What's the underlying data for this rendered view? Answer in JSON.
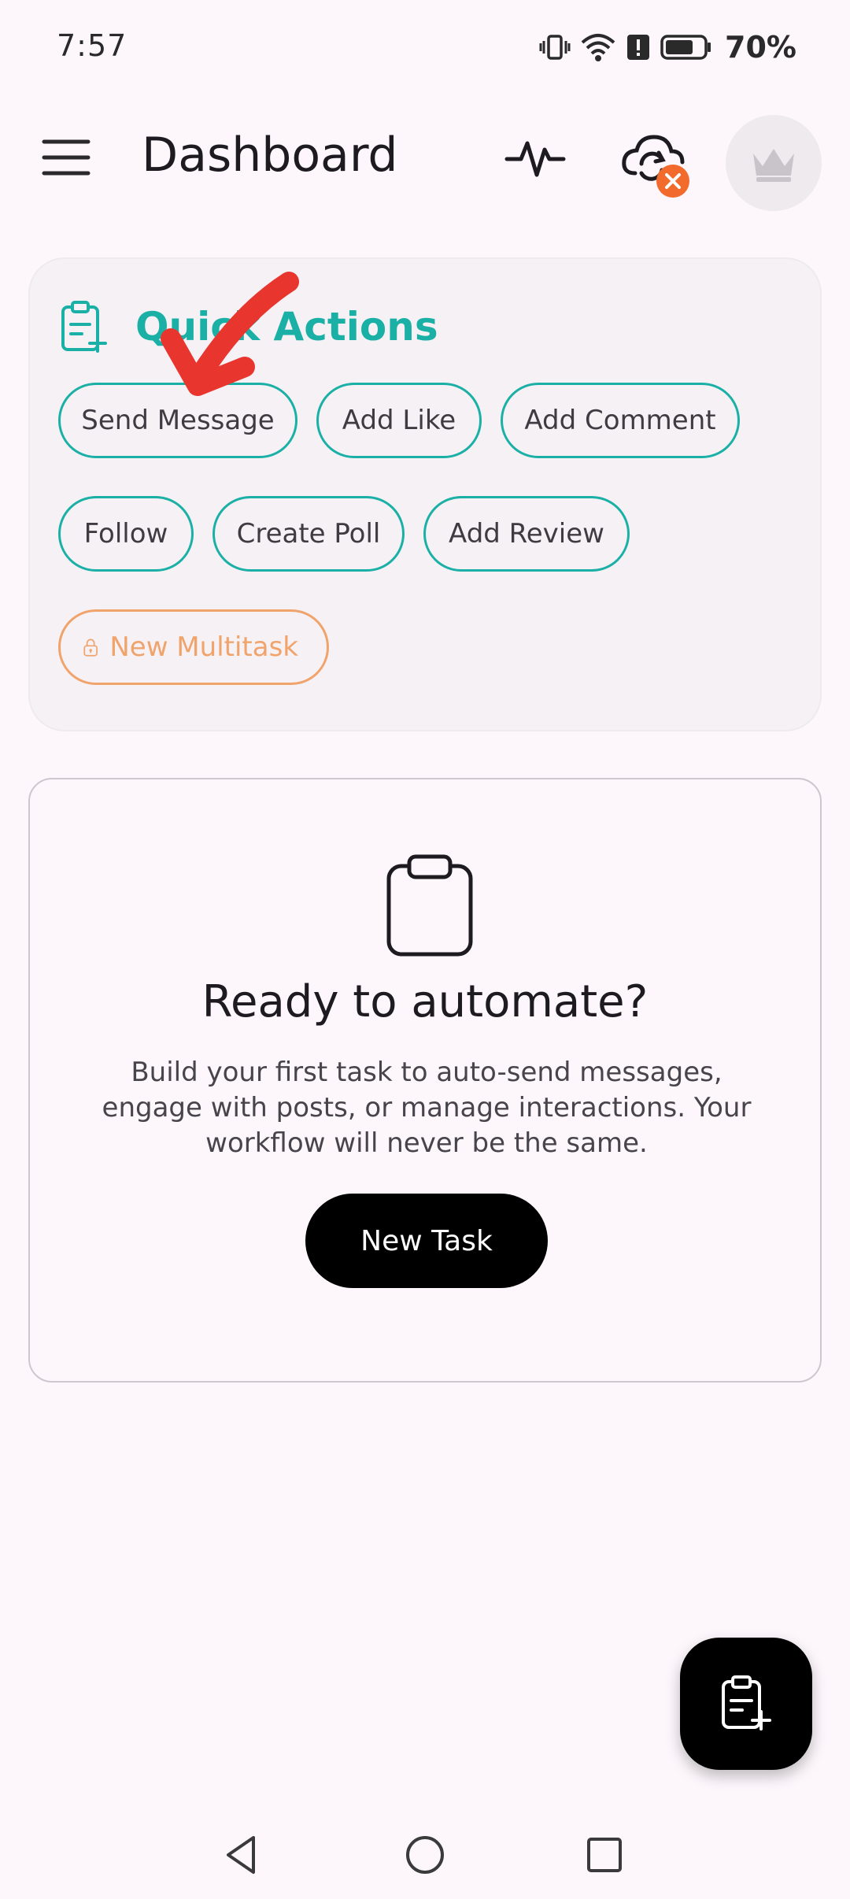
{
  "status_bar": {
    "time": "7:57",
    "battery_percent": "70%"
  },
  "app_bar": {
    "title": "Dashboard"
  },
  "quick_actions": {
    "title": "Quick Actions",
    "chips": [
      {
        "label": "Send Message"
      },
      {
        "label": "Add Like"
      },
      {
        "label": "Add Comment"
      },
      {
        "label": "Follow"
      },
      {
        "label": "Create Poll"
      },
      {
        "label": "Add Review"
      },
      {
        "label": "New Multitask",
        "locked": true
      }
    ]
  },
  "empty_state": {
    "title": "Ready to automate?",
    "description": "Build your first task to auto-send messages, engage with posts, or manage interactions. Your workflow will never be the same.",
    "button_label": "New Task"
  },
  "colors": {
    "accent_teal": "#1bb0a6",
    "locked_orange": "#f0a36b",
    "badge_orange": "#f26b2c",
    "annotation_red": "#e8352e",
    "background": "#fdf7fc"
  },
  "icons": {
    "menu": "hamburger-menu-icon",
    "activity": "pulse-icon",
    "cloud_sync": "cloud-sync-error-icon",
    "premium": "crown-icon",
    "quick_actions": "clipboard-add-icon",
    "lock": "lock-icon",
    "empty": "clipboard-icon",
    "fab": "clipboard-add-icon"
  }
}
